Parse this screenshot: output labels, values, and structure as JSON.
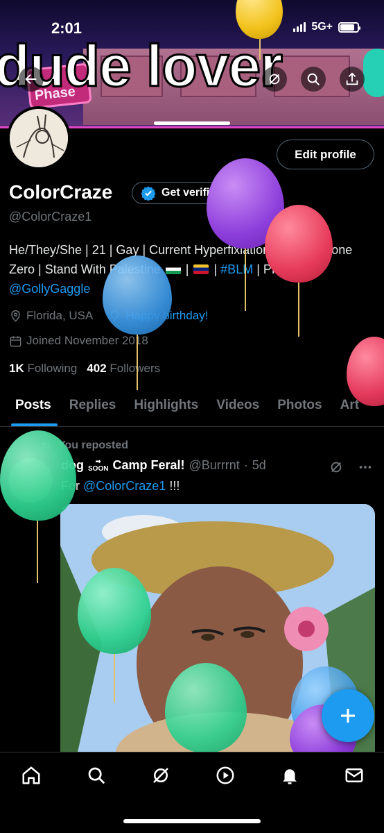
{
  "status_bar": {
    "time": "2:01",
    "network": "5G+",
    "battery_level": 0.85
  },
  "banner": {
    "overlay_text": "dude lover",
    "sign_text": "Phase"
  },
  "profile": {
    "display_name": "ColorCraze",
    "verify_label": "Get verified",
    "handle": "@ColorCraze1",
    "edit_button": "Edit profile",
    "bio_text": "He/They/She | 21 | Gay | Current Hyperfixiation: Zenless Zone Zero | Stand With Palestine",
    "bio_separator_1": " | ",
    "bio_hashtag": "#BLM",
    "bio_pfp_label": " | PFP: ",
    "bio_mention": "@GollyGaggle",
    "location": "Florida, USA",
    "birthday": "Happy birthday!",
    "joined": "Joined November 2018",
    "following_count": "1K",
    "following_label": "Following",
    "followers_count": "402",
    "followers_label": "Followers"
  },
  "tabs": [
    "Posts",
    "Replies",
    "Highlights",
    "Videos",
    "Photos",
    "Art"
  ],
  "post": {
    "repost_label": "You reposted",
    "author": "dog",
    "author_suffix": "Camp Feral!",
    "author_badge": "SOON",
    "handle": "@Burrrnt",
    "time": "5d",
    "text_prefix": "For ",
    "mention": "@ColorCraze1",
    "text_suffix": " !!!"
  },
  "colors": {
    "accent": "#1d9bf0",
    "background": "#000000",
    "muted": "#71767b"
  },
  "icons": [
    "back-arrow-icon",
    "grok-icon",
    "search-icon",
    "share-icon",
    "verified-badge-icon",
    "location-icon",
    "balloon-icon",
    "calendar-icon",
    "repost-icon",
    "home-icon",
    "search-nav-icon",
    "grok-nav-icon",
    "video-icon",
    "bell-icon",
    "mail-icon",
    "compose-plus-icon"
  ]
}
